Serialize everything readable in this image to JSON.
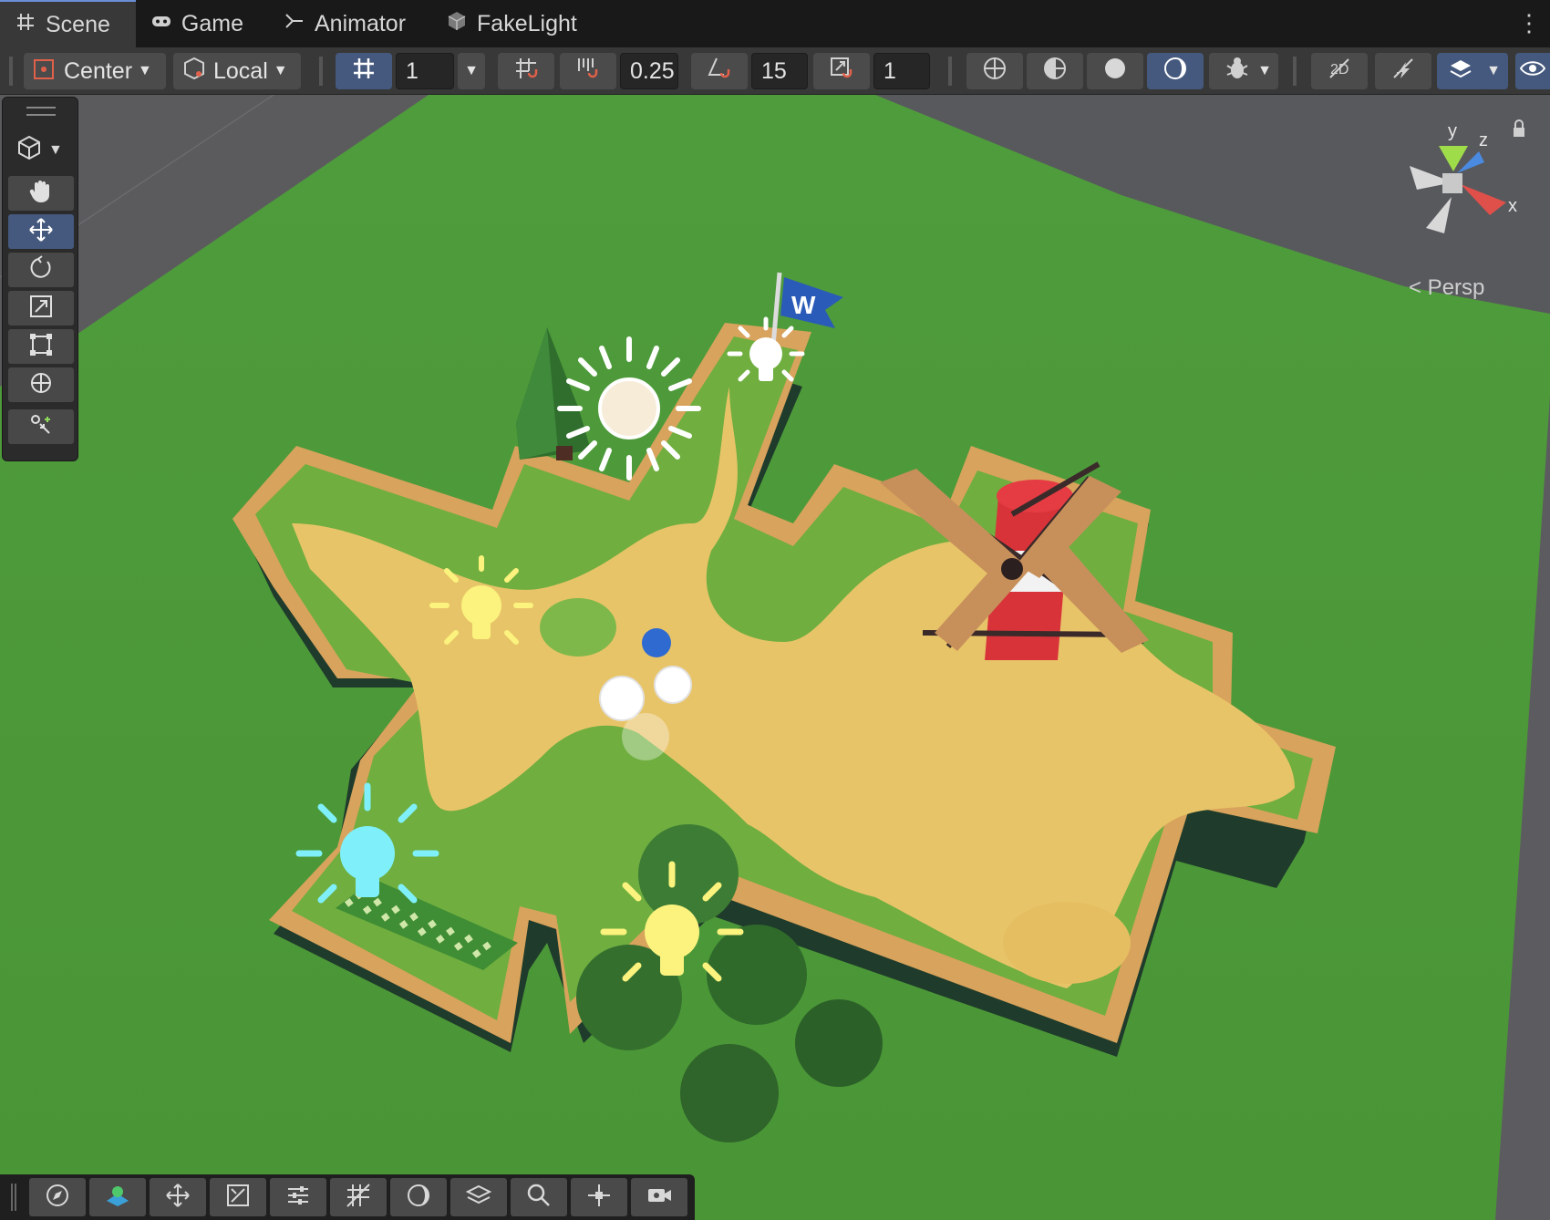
{
  "tabs": [
    {
      "label": "Scene",
      "icon": "grid-icon",
      "active": true
    },
    {
      "label": "Game",
      "icon": "gamepad-icon",
      "active": false
    },
    {
      "label": "Animator",
      "icon": "animator-icon",
      "active": false
    },
    {
      "label": "FakeLight",
      "icon": "package-icon",
      "active": false
    }
  ],
  "toolbar": {
    "pivot_mode": "Center",
    "pivot_rotation": "Local",
    "grid_size": "1",
    "snap_increment": "0.25",
    "rotation_snap": "15",
    "scale_snap": "1"
  },
  "gizmo": {
    "axis_y": "y",
    "axis_z": "z",
    "axis_x": "x",
    "projection": "< Persp",
    "colors": {
      "x": "#e0504a",
      "y": "#9fdc4a",
      "z": "#4a8ae0"
    }
  },
  "scene_objects": {
    "flag_letter": "W"
  },
  "tool_overlay": {
    "tools": [
      "hand-tool",
      "move-tool",
      "rotate-tool",
      "scale-tool",
      "rect-tool",
      "transform-tool",
      "custom-tool"
    ]
  },
  "colors": {
    "accent": "#45597e",
    "grass": "#4d9a3a",
    "sand": "#e8c46a",
    "wall": "#d7a25f"
  }
}
